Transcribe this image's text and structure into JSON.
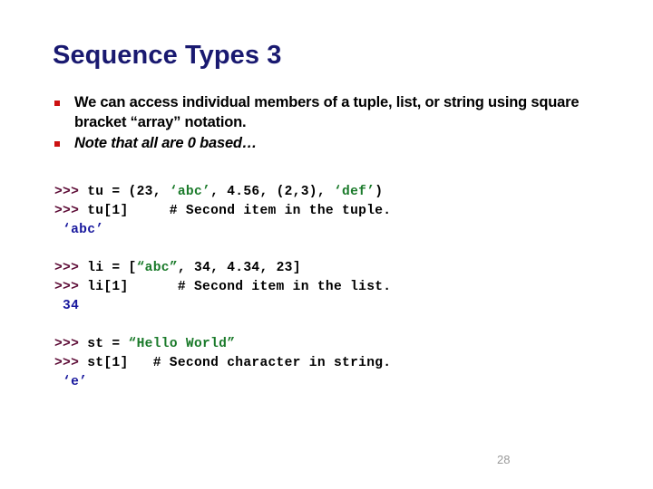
{
  "slide": {
    "title": "Sequence Types 3",
    "title_color": "#191970",
    "page_number": "28",
    "background_color": "#ffffff"
  },
  "bullets": [
    {
      "text": "We can access individual members of a tuple, list, or string using square bracket “array” notation.",
      "style": "bold",
      "marker_color": "#cc1111"
    },
    {
      "text": "Note that all are 0 based…",
      "style": "bold-italic",
      "marker_color": "#cc1111"
    }
  ],
  "code": {
    "prompt_color": "#5c0a35",
    "string_color": "#1a7a2a",
    "output_color": "#1a1a9e",
    "plain_color": "#000000",
    "blocks": [
      {
        "name": "tuple-example",
        "lines": [
          {
            "name": "tuple-assign-line",
            "segments": [
              {
                "kind": "prompt",
                "text": ">>> "
              },
              {
                "kind": "plain",
                "text": "tu = (23, "
              },
              {
                "kind": "str",
                "text": "‘abc’"
              },
              {
                "kind": "plain",
                "text": ", 4.56, (2,3), "
              },
              {
                "kind": "str",
                "text": "‘def’"
              },
              {
                "kind": "plain",
                "text": ")"
              }
            ]
          },
          {
            "name": "tuple-index-line",
            "segments": [
              {
                "kind": "prompt",
                "text": ">>> "
              },
              {
                "kind": "plain",
                "text": "tu[1]     # Second item in the tuple."
              }
            ]
          },
          {
            "name": "tuple-output-line",
            "segments": [
              {
                "kind": "out",
                "text": " ‘abc’"
              }
            ]
          }
        ]
      },
      {
        "name": "list-example",
        "lines": [
          {
            "name": "list-assign-line",
            "segments": [
              {
                "kind": "prompt",
                "text": ">>> "
              },
              {
                "kind": "plain",
                "text": "li = ["
              },
              {
                "kind": "str",
                "text": "“abc”"
              },
              {
                "kind": "plain",
                "text": ", 34, 4.34, 23]"
              }
            ]
          },
          {
            "name": "list-index-line",
            "segments": [
              {
                "kind": "prompt",
                "text": ">>> "
              },
              {
                "kind": "plain",
                "text": "li[1]      # Second item in the list."
              }
            ]
          },
          {
            "name": "list-output-line",
            "segments": [
              {
                "kind": "out",
                "text": " 34"
              }
            ]
          }
        ]
      },
      {
        "name": "string-example",
        "lines": [
          {
            "name": "string-assign-line",
            "segments": [
              {
                "kind": "prompt",
                "text": ">>> "
              },
              {
                "kind": "plain",
                "text": "st = "
              },
              {
                "kind": "str",
                "text": "“Hello World”"
              }
            ]
          },
          {
            "name": "string-index-line",
            "segments": [
              {
                "kind": "prompt",
                "text": ">>> "
              },
              {
                "kind": "plain",
                "text": "st[1]   # Second character in string."
              }
            ]
          },
          {
            "name": "string-output-line",
            "segments": [
              {
                "kind": "out",
                "text": " ‘e’"
              }
            ]
          }
        ]
      }
    ]
  }
}
